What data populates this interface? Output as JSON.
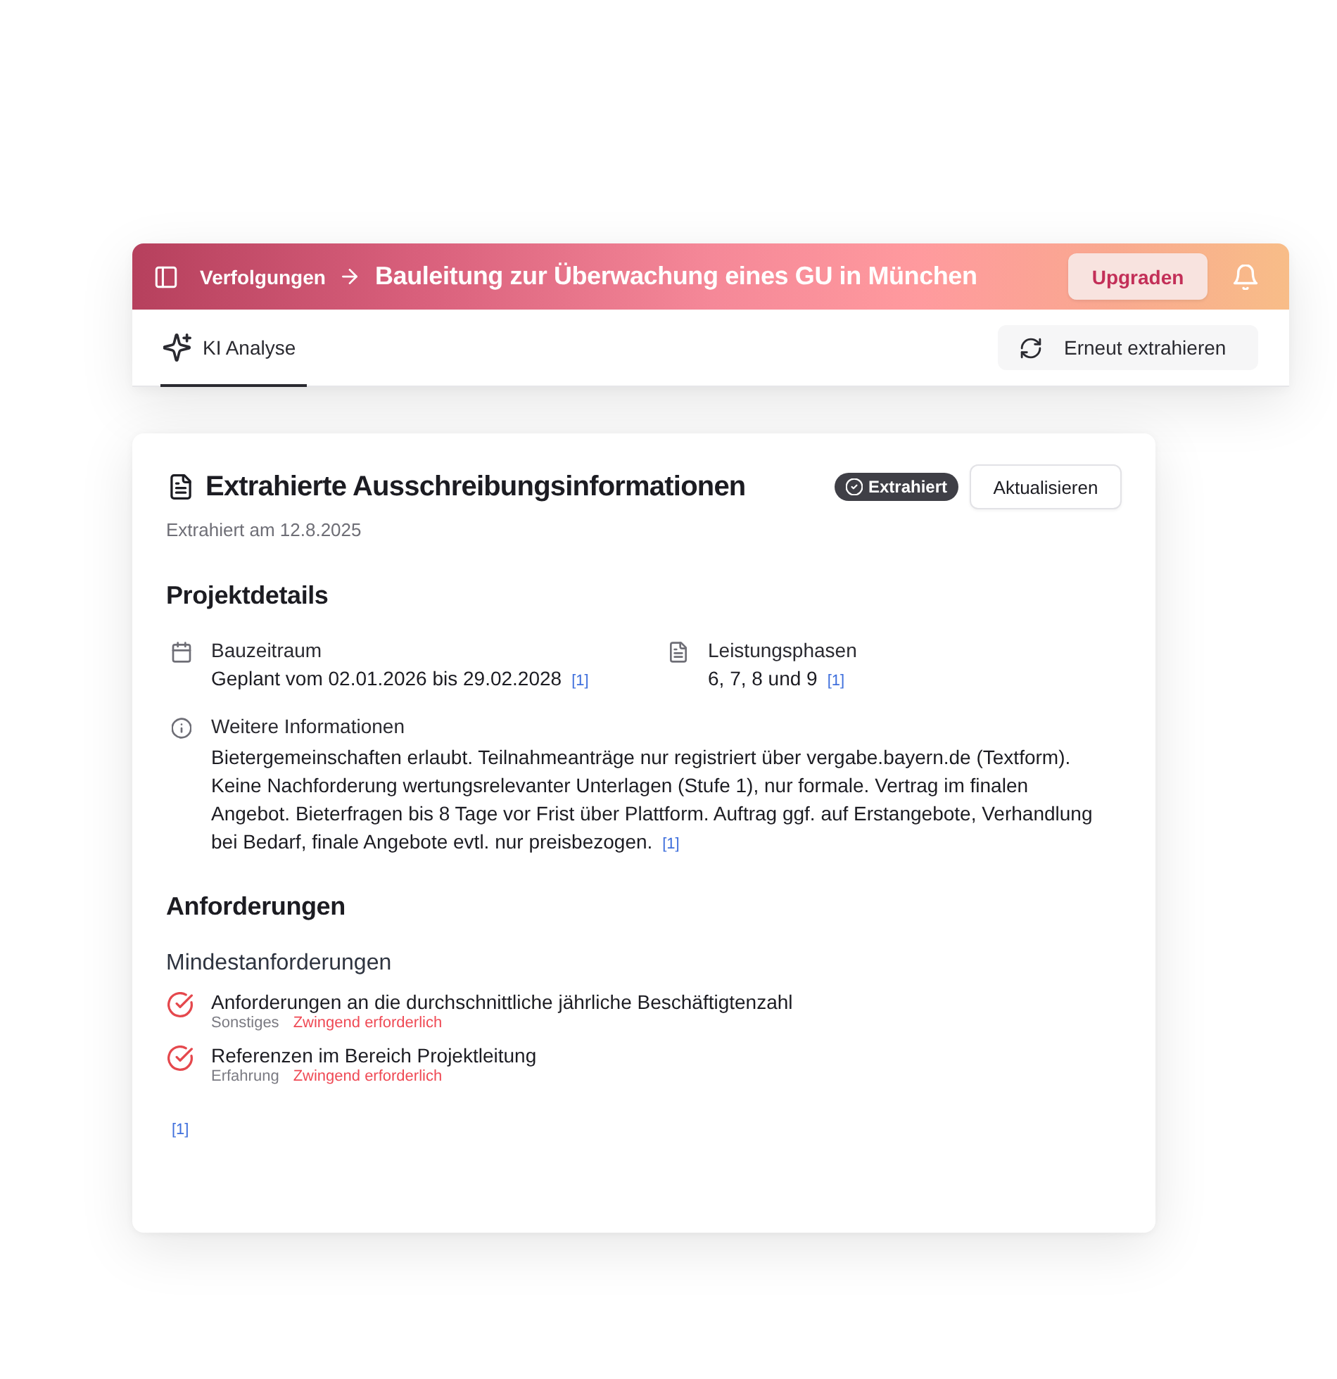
{
  "header": {
    "breadcrumb": "Verfolgungen",
    "title": "Bauleitung zur Überwachung eines GU in München",
    "upgrade_button": "Upgraden"
  },
  "tabs": [
    {
      "label": "KI Analyse",
      "selected": true
    }
  ],
  "reextract_button": "Erneut extrahieren",
  "card": {
    "title": "Extrahierte Ausschreibungsinformationen",
    "status_badge": "Extrahiert",
    "update_button": "Aktualisieren",
    "extracted_on": "Extrahiert am 12.8.2025"
  },
  "project_details": {
    "heading": "Projektdetails",
    "construction_period": {
      "label": "Bauzeitraum",
      "value": "Geplant vom 02.01.2026 bis 29.02.2028",
      "citation": "[1]"
    },
    "service_phases": {
      "label": "Leistungsphasen",
      "value": "6, 7, 8 und 9",
      "citation": "[1]"
    },
    "further_information": {
      "label": "Weitere Informationen",
      "value": "Bietergemeinschaften erlaubt. Teilnahmeanträge nur registriert über vergabe.bayern.de (Textform). Keine Nachforderung wertungsrelevanter Unterlagen (Stufe 1), nur formale. Vertrag im finalen Angebot. Bieterfragen bis 8 Tage vor Frist über Plattform. Auftrag ggf. auf Erstangebote, Verhandlung bei Bedarf, finale Angebote evtl. nur preisbezogen.",
      "citation": "[1]"
    }
  },
  "requirements": {
    "heading": "Anforderungen",
    "subheading": "Mindestanforderungen",
    "items": [
      {
        "title": "Anforderungen an die durchschnittliche jährliche Beschäftigtenzahl",
        "category": "Sonstiges",
        "obligation": "Zwingend erforderlich"
      },
      {
        "title": "Referenzen im Bereich Projektleitung",
        "category": "Erfahrung",
        "obligation": "Zwingend erforderlich"
      }
    ],
    "citation": "[1]"
  }
}
